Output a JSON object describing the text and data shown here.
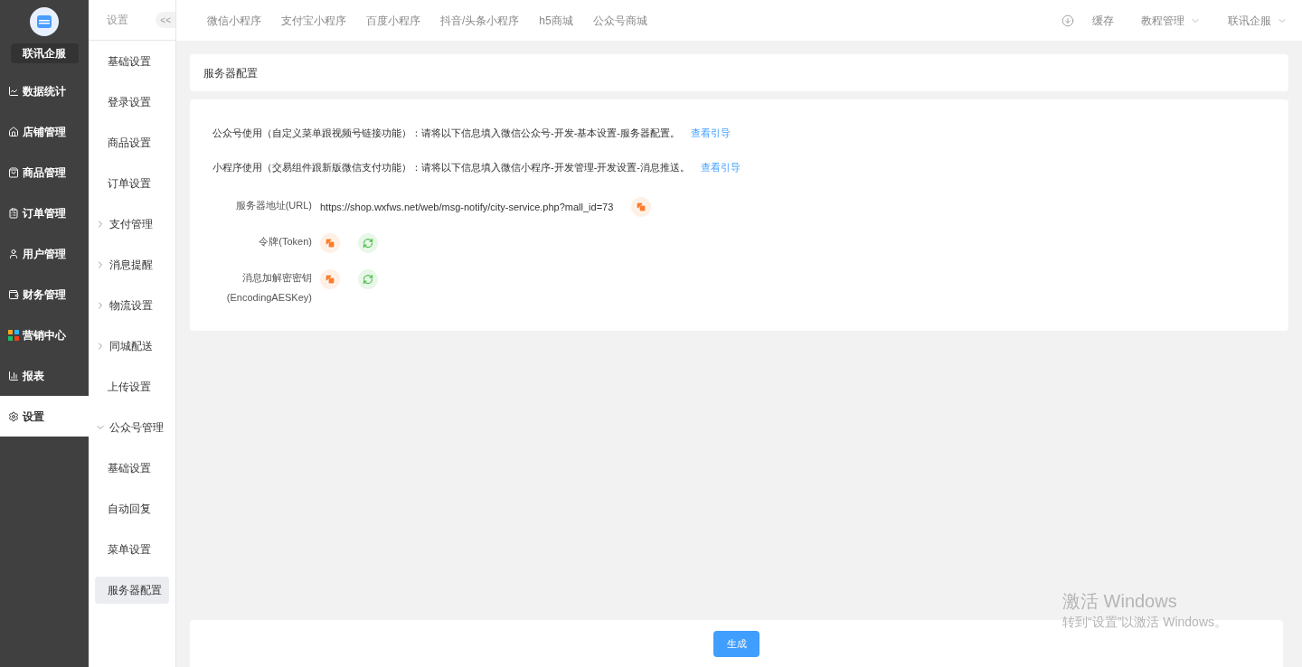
{
  "brand": {
    "name": "联讯企服"
  },
  "sidebar": {
    "items": [
      {
        "label": "数据统计",
        "selected": false
      },
      {
        "label": "店铺管理",
        "selected": false
      },
      {
        "label": "商品管理",
        "selected": false
      },
      {
        "label": "订单管理",
        "selected": false
      },
      {
        "label": "用户管理",
        "selected": false
      },
      {
        "label": "财务管理",
        "selected": false
      },
      {
        "label": "营销中心",
        "selected": false
      },
      {
        "label": "报表",
        "selected": false
      },
      {
        "label": "设置",
        "selected": true
      }
    ]
  },
  "submenu": {
    "title": "设置",
    "collapse_label": "<<",
    "items": [
      {
        "kind": "link",
        "label": "基础设置",
        "selected": false
      },
      {
        "kind": "link",
        "label": "登录设置",
        "selected": false
      },
      {
        "kind": "link",
        "label": "商品设置",
        "selected": false
      },
      {
        "kind": "link",
        "label": "订单设置",
        "selected": false
      },
      {
        "kind": "group",
        "label": "支付管理",
        "expanded": false
      },
      {
        "kind": "group",
        "label": "消息提醒",
        "expanded": false
      },
      {
        "kind": "group",
        "label": "物流设置",
        "expanded": false
      },
      {
        "kind": "group",
        "label": "同城配送",
        "expanded": false
      },
      {
        "kind": "link",
        "label": "上传设置",
        "selected": false
      },
      {
        "kind": "group",
        "label": "公众号管理",
        "expanded": true,
        "children": [
          {
            "kind": "link",
            "label": "基础设置",
            "selected": false
          },
          {
            "kind": "link",
            "label": "自动回复",
            "selected": false
          },
          {
            "kind": "link",
            "label": "菜单设置",
            "selected": false
          },
          {
            "kind": "link",
            "label": "服务器配置",
            "selected": true
          }
        ]
      }
    ]
  },
  "top_nav": {
    "tabs": [
      {
        "label": "微信小程序",
        "selected": false
      },
      {
        "label": "支付宝小程序",
        "selected": false
      },
      {
        "label": "百度小程序",
        "selected": false
      },
      {
        "label": "抖音/头条小程序",
        "selected": false
      },
      {
        "label": "h5商城",
        "selected": false
      },
      {
        "label": "公众号商城",
        "selected": false
      }
    ],
    "cache": "缓存",
    "menus": [
      "教程管理",
      "联讯企服"
    ]
  },
  "page": {
    "title": "服务器配置",
    "notes": [
      {
        "text": "公众号使用（自定义菜单跟视频号链接功能）：请将以下信息填入微信公众号-开发-基本设置-服务器配置。",
        "link": "查看引导"
      },
      {
        "text": "小程序使用（交易组件跟新版微信支付功能）：请将以下信息填入微信小程序-开发管理-开发设置-消息推送。",
        "link": "查看引导"
      }
    ],
    "fields": [
      {
        "kind": "url",
        "label": "服务器地址(URL)",
        "value": "https://shop.wxfws.net/web/msg-notify/city-service.php?mall_id=73"
      },
      {
        "kind": "key",
        "label": "令牌(Token)"
      },
      {
        "kind": "key",
        "label": "消息加解密密钥",
        "label_2": "(EncodingAESKey)"
      }
    ],
    "submit": "生成"
  },
  "os_watermark": {
    "title": "激活 Windows",
    "subtitle": "转到“设置”以激活 Windows。"
  }
}
